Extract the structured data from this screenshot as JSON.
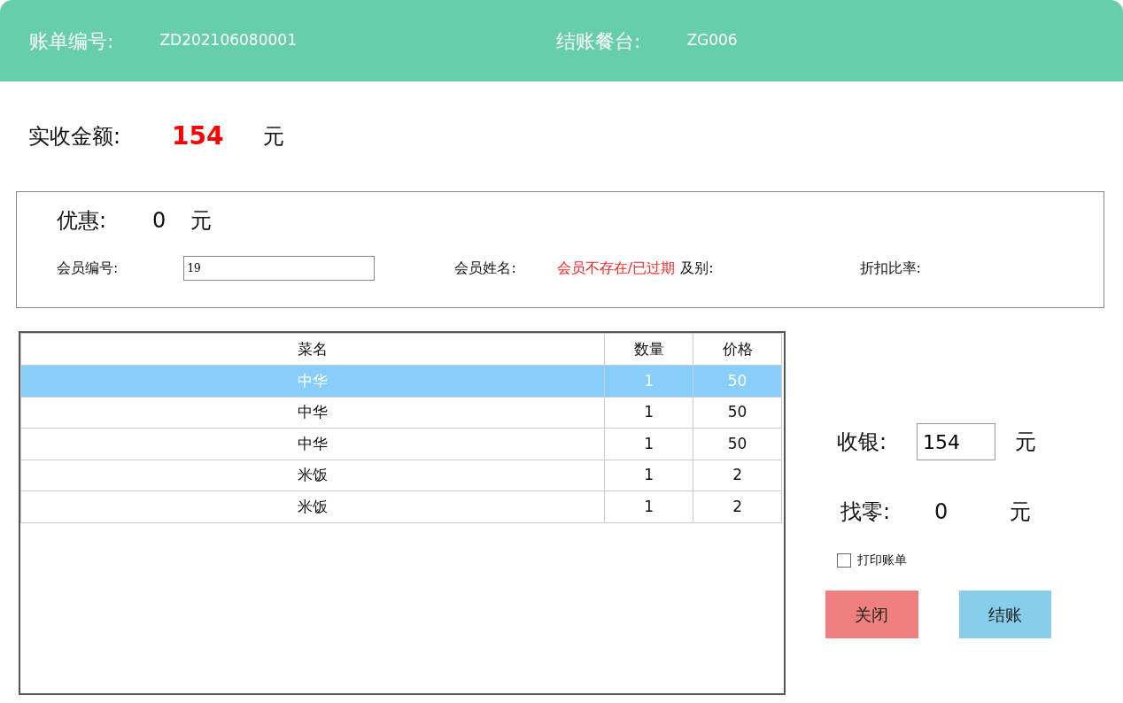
{
  "header": {
    "bill_label": "账单编号:",
    "bill_no": "ZD202106080001",
    "table_label": "结账餐台:",
    "table_no": "ZG006"
  },
  "amount": {
    "label": "实收金额:",
    "value": "154",
    "unit": "元"
  },
  "member_box": {
    "discount_label": "优惠:",
    "discount_value": "0",
    "discount_unit": "元",
    "member_no_label": "会员编号:",
    "member_no_value": "19",
    "member_name_label": "会员姓名:",
    "member_name_value": "会员不存在/已过期",
    "level_label": "及别:",
    "rate_label": "折扣比率:"
  },
  "table": {
    "columns": [
      "菜名",
      "数量",
      "价格"
    ],
    "rows": [
      {
        "cells": [
          "中华",
          "1",
          "50"
        ],
        "selected": true
      },
      {
        "cells": [
          "中华",
          "1",
          "50"
        ],
        "selected": false
      },
      {
        "cells": [
          "中华",
          "1",
          "50"
        ],
        "selected": false
      },
      {
        "cells": [
          "米饭",
          "1",
          "2"
        ],
        "selected": false
      },
      {
        "cells": [
          "米饭",
          "1",
          "2"
        ],
        "selected": false
      }
    ]
  },
  "payment": {
    "received_label": "收银:",
    "received_value": "154",
    "received_unit": "元",
    "change_label": "找零:",
    "change_value": "0",
    "change_unit": "元"
  },
  "print_bill": {
    "label": "打印账单",
    "checked": false
  },
  "buttons": [
    {
      "label": "关闭",
      "kind": "close"
    },
    {
      "label": "结账",
      "kind": "checkout"
    }
  ]
}
